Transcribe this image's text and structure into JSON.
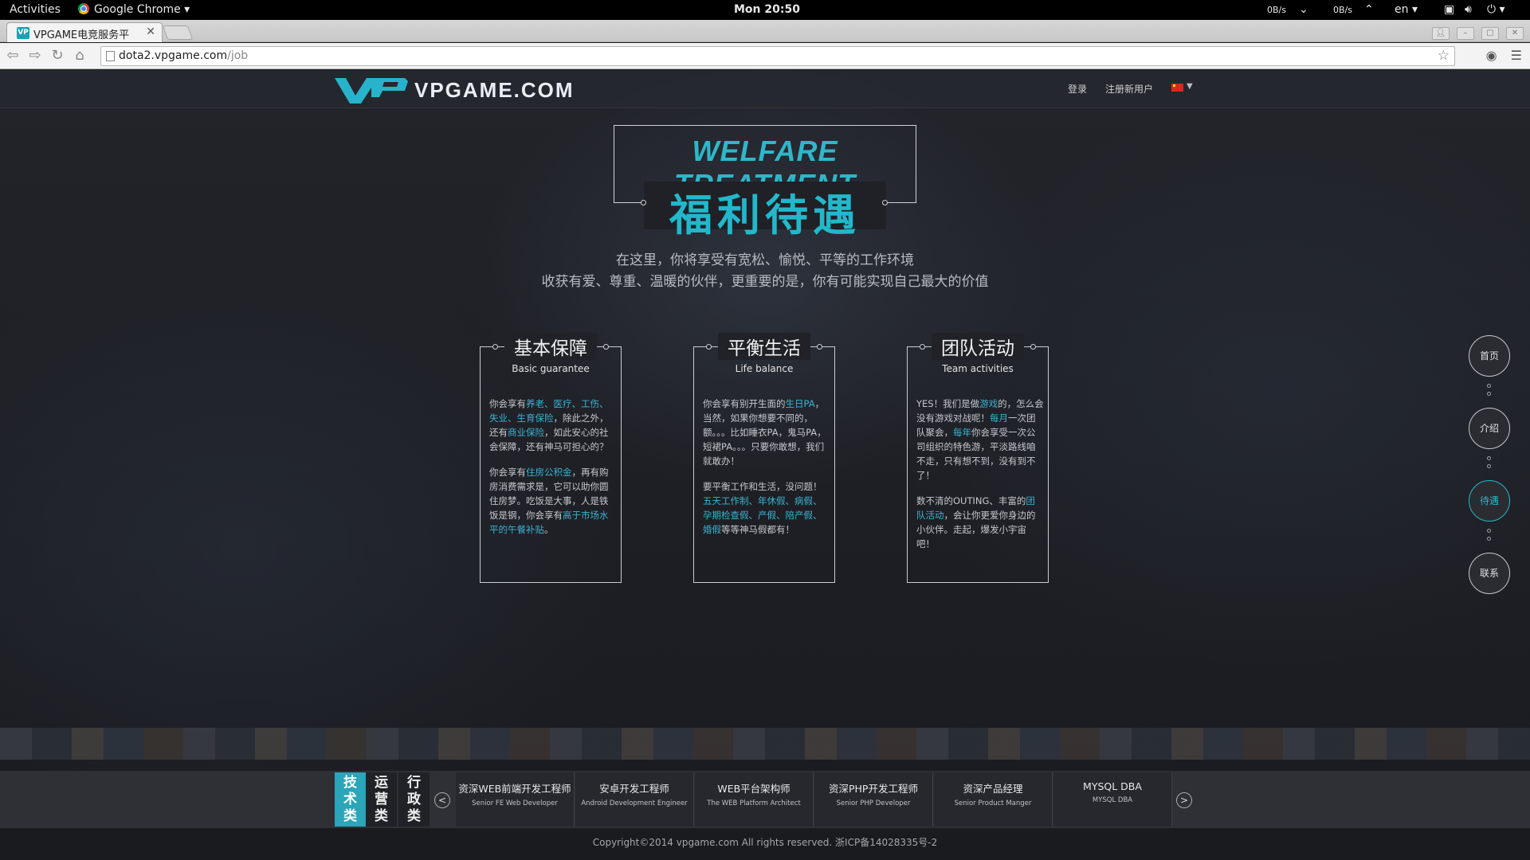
{
  "system_bar": {
    "activities": "Activities",
    "app_name": "Google Chrome",
    "clock": "Mon 20:50",
    "net_down": "0B/s",
    "net_up": "0B/s",
    "lang": "en"
  },
  "browser": {
    "tab_title": "VPGAME电竞服务平",
    "favicon_text": "VP",
    "url_host": "dota2.vpgame.com",
    "url_path": "/job"
  },
  "header": {
    "logo_text": "VPGAME.COM",
    "login": "登录",
    "register": "注册新用户"
  },
  "hero": {
    "title_en": "WELFARE TREATMENT",
    "title_cn": "福利待遇",
    "intro_line1": "在这里，你将享受有宽松、愉悦、平等的工作环境",
    "intro_line2": "收获有爱、尊重、温暖的伙伴，更重要的是，你有可能实现自己最大的价值"
  },
  "cards": [
    {
      "title": "基本保障",
      "subtitle": "Basic guarantee",
      "p1": [
        "你会享有",
        "养老、医疗、工伤、失业、生育保险",
        "，除此之外，还有",
        "商业保险",
        "，如此安心的社会保障，还有神马可担心的？"
      ],
      "p2": [
        "你会享有",
        "住房公积金",
        "，再有购房消费需求是，它可以助你圆住房梦。吃饭是大事，人是铁饭是钢，你会享有",
        "高于市场水平的午餐补贴",
        "。"
      ]
    },
    {
      "title": "平衡生活",
      "subtitle": "Life balance",
      "p1": [
        "你会享有别开生面的",
        "生日PA",
        "，当然，如果你想要不同的，额。。。比如睡衣PA，鬼马PA，短裙PA。。。只要你敢想，我们就敢办！"
      ],
      "p2": [
        "要平衡工作和生活，没问题！",
        "五天工作制、年休假、病假、孕期检查假、产假、陪产假、婚假",
        "等等神马假都有！"
      ]
    },
    {
      "title": "团队活动",
      "subtitle": "Team activities",
      "p1": [
        "YES！我们是做",
        "游戏",
        "的，怎么会没有游戏对战呢！",
        "每月",
        "一次团队聚会，",
        "每年",
        "你会享受一次公司组织的特色游，平淡路线咱不走，只有想不到，没有到不了！"
      ],
      "p2": [
        "数不清的OUTING、丰富的",
        "团队活动",
        "，会让你更爱你身边的小伙伴。走起，爆发小宇宙吧！"
      ]
    }
  ],
  "side_nav": [
    "首页",
    "介绍",
    "待遇",
    "联系"
  ],
  "side_nav_active": "待遇",
  "job_categories": {
    "tech": [
      "技",
      "术",
      "类"
    ],
    "ops": [
      "运",
      "营",
      "类"
    ],
    "admin": [
      "行",
      "政",
      "类"
    ]
  },
  "jobs": [
    {
      "cn": "资深WEB前端开发工程师",
      "en": "Senior FE Web Developer"
    },
    {
      "cn": "安卓开发工程师",
      "en": "Android Development Engineer"
    },
    {
      "cn": "WEB平台架构师",
      "en": "The WEB Platform Architect"
    },
    {
      "cn": "资深PHP开发工程师",
      "en": "Senior PHP Developer"
    },
    {
      "cn": "资深产品经理",
      "en": "Senior Product Manger"
    },
    {
      "cn": "MYSQL DBA",
      "en": "MYSQL DBA"
    }
  ],
  "footer": "Copyright©2014 vpgame.com All rights reserved. 浙ICP备14028335号-2",
  "colors": {
    "accent": "#28b7c8",
    "link": "#3ab3d2",
    "background": "#1e1f23"
  }
}
